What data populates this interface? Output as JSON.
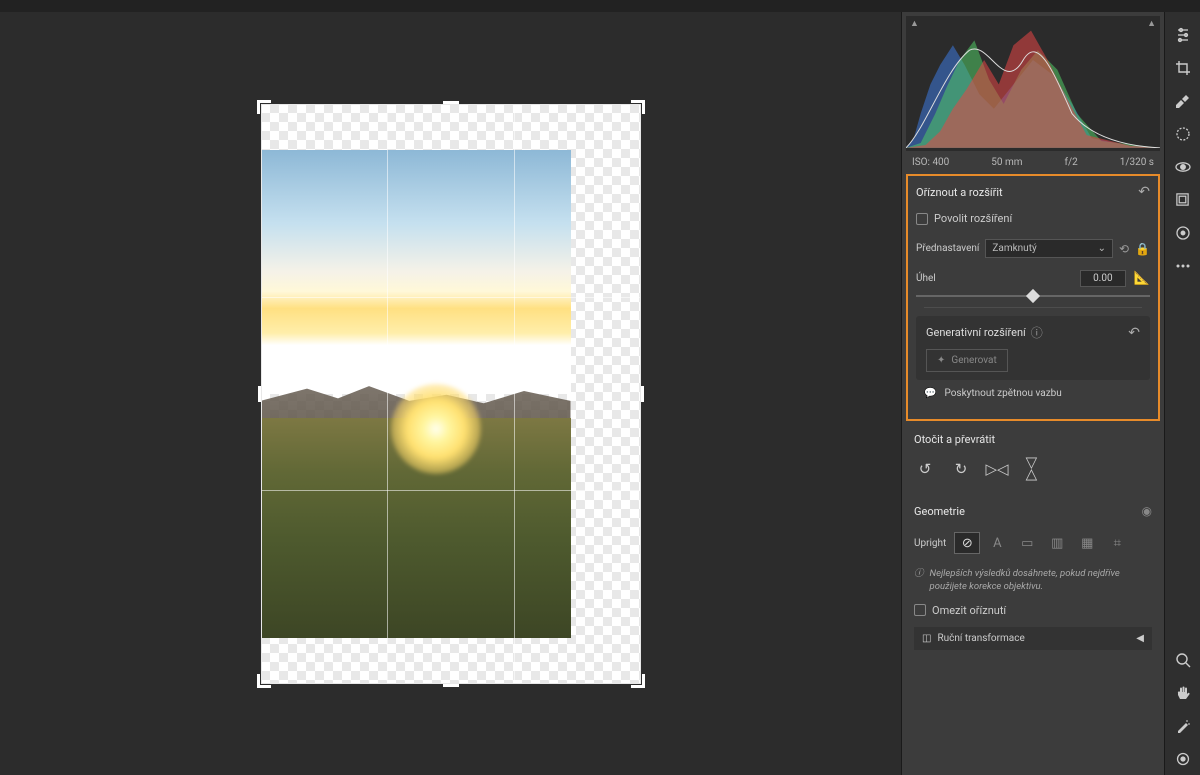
{
  "exif": {
    "iso": "ISO: 400",
    "focal": "50 mm",
    "aperture": "f/2",
    "shutter": "1/320 s"
  },
  "crop_panel": {
    "title": "Oříznout a rozšířit",
    "checkbox_label": "Povolit rozšíření",
    "preset_label": "Přednastavení",
    "preset_value": "Zamknutý",
    "angle_label": "Úhel",
    "angle_value": "0.00",
    "gen_title": "Generativní rozšíření",
    "gen_button": "Generovat",
    "feedback": "Poskytnout zpětnou vazbu"
  },
  "rotate_panel": {
    "title": "Otočit a převrátit"
  },
  "geometry_panel": {
    "title": "Geometrie",
    "upright_label": "Upright",
    "hint": "Nejlepších výsledků dosáhnete, pokud nejdříve použijete korekce objektivu.",
    "limit_label": "Omezit oříznutí",
    "manual_label": "Ruční transformace"
  }
}
